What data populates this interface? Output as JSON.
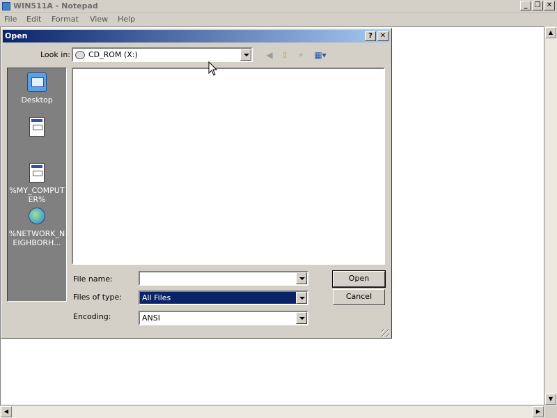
{
  "notepad": {
    "title": "WIN511A - Notepad",
    "menu": [
      "File",
      "Edit",
      "Format",
      "View",
      "Help"
    ]
  },
  "dialog": {
    "title": "Open",
    "look_in_label": "Look in:",
    "look_in_value": "CD_ROM (X:)",
    "places": [
      {
        "label": "Desktop",
        "icon": "desktop-icon"
      },
      {
        "label": "",
        "icon": "document-icon"
      },
      {
        "label": "%MY_COMPUTER%",
        "icon": "document-icon"
      },
      {
        "label": "%NETWORK_NEIGHBORH...",
        "icon": "network-icon"
      }
    ],
    "file_name_label": "File name:",
    "file_name_value": "",
    "files_of_type_label": "Files of type:",
    "files_of_type_value": "All Files",
    "encoding_label": "Encoding:",
    "encoding_value": "ANSI",
    "open_button": "Open",
    "cancel_button": "Cancel",
    "help_glyph": "?",
    "close_glyph": "✕"
  },
  "colors": {
    "title_active": "#0a246a",
    "selection": "#0a246a",
    "places_bg": "#808080"
  }
}
